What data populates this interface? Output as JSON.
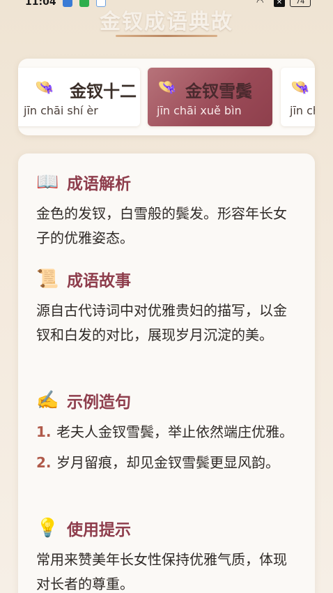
{
  "status": {
    "time": "11:04",
    "battery": "74",
    "icons": [
      "notification-app-icon",
      "wechat-icon",
      "baidu-icon",
      "wifi-icon",
      "close-x-icon",
      "battery-icon"
    ]
  },
  "app": {
    "title": "金钗成语典故"
  },
  "carousel": {
    "cards": [
      {
        "icon": "👒",
        "name": "金钗十二",
        "pinyin": "jīn chāi shí èr"
      },
      {
        "icon": "👒",
        "name": "金钗雪鬓",
        "pinyin": "jīn chāi xuě bìn"
      },
      {
        "icon": "👒",
        "name": "",
        "pinyin": "jīn ch"
      }
    ]
  },
  "detail": {
    "meaning": {
      "icon": "📖",
      "title": "成语解析",
      "text": "金色的发钗，白雪般的鬓发。形容年长女子的优雅姿态。"
    },
    "story": {
      "icon": "📜",
      "title": "成语故事",
      "text": "源自古代诗词中对优雅贵妇的描写，以金钗和白发的对比，展现岁月沉淀的美。"
    },
    "examples": {
      "icon": "✍️",
      "title": "示例造句",
      "items": [
        {
          "num": "1.",
          "text": "老夫人金钗雪鬓，举止依然端庄优雅。"
        },
        {
          "num": "2.",
          "text": "岁月留痕，却见金钗雪鬓更显风韵。"
        }
      ]
    },
    "usage": {
      "icon": "💡",
      "title": "使用提示",
      "text": "常用来赞美年长女性保持优雅气质，体现对长者的尊重。"
    }
  },
  "colors": {
    "accent": "#8e3d4c",
    "active_card": "#9a4a57",
    "number": "#b05a4a"
  }
}
